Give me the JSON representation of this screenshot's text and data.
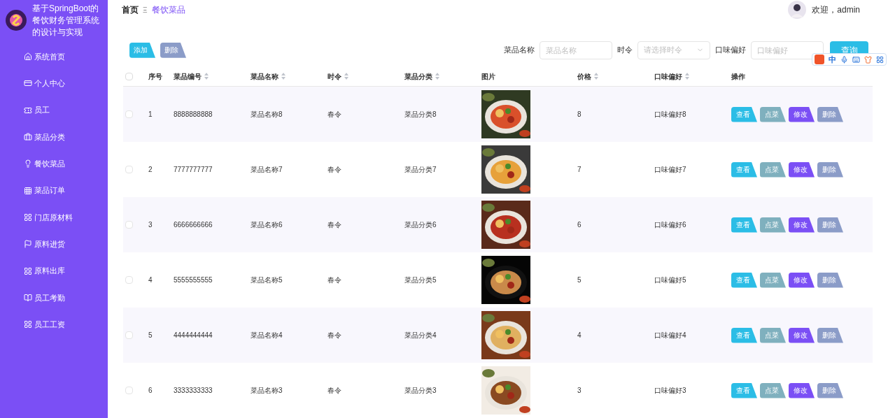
{
  "app": {
    "title": "基于SpringBoot的餐饮财务管理系统的设计与实现"
  },
  "sidebar": {
    "items": [
      "系统首页",
      "个人中心",
      "员工",
      "菜品分类",
      "餐饮菜品",
      "菜品订单",
      "门店原材料",
      "原料进货",
      "原料出库",
      "员工考勤",
      "员工工资"
    ]
  },
  "breadcrumb": {
    "home": "首页",
    "separator": "Ξ",
    "current": "餐饮菜品"
  },
  "user": {
    "greeting": "欢迎，admin"
  },
  "toolbar": {
    "add": "添加",
    "delete": "删除"
  },
  "search": {
    "fields": [
      {
        "kind": "input",
        "label": "菜品名称",
        "placeholder": "菜品名称"
      },
      {
        "kind": "select",
        "label": "时令",
        "placeholder": "请选择时令"
      },
      {
        "kind": "input",
        "label": "口味偏好",
        "placeholder": "口味偏好"
      }
    ],
    "button": "查询"
  },
  "ime_toolbar": {
    "mode": "中"
  },
  "table": {
    "all_checked": false,
    "columns": [
      {
        "label": "序号",
        "sortable": false
      },
      {
        "label": "菜品编号",
        "sortable": true
      },
      {
        "label": "菜品名称",
        "sortable": true
      },
      {
        "label": "时令",
        "sortable": true
      },
      {
        "label": "菜品分类",
        "sortable": true
      },
      {
        "label": "图片",
        "sortable": false
      },
      {
        "label": "价格",
        "sortable": true
      },
      {
        "label": "口味偏好",
        "sortable": true
      },
      {
        "label": "操作",
        "sortable": false
      }
    ],
    "rows": [
      {
        "checked": false,
        "index": "1",
        "code": "8888888888",
        "name": "菜品名称8",
        "season": "春令",
        "category": "菜品分类8",
        "price": "8",
        "taste": "口味偏好8",
        "actions": [
          {
            "kind": "view",
            "label": "查看"
          },
          {
            "kind": "order",
            "label": "点菜"
          },
          {
            "kind": "edit",
            "label": "修改"
          },
          {
            "kind": "delete",
            "label": "删除"
          }
        ]
      },
      {
        "checked": false,
        "index": "2",
        "code": "7777777777",
        "name": "菜品名称7",
        "season": "春令",
        "category": "菜品分类7",
        "price": "7",
        "taste": "口味偏好7",
        "actions": [
          {
            "kind": "view",
            "label": "查看"
          },
          {
            "kind": "order",
            "label": "点菜"
          },
          {
            "kind": "edit",
            "label": "修改"
          },
          {
            "kind": "delete",
            "label": "删除"
          }
        ]
      },
      {
        "checked": false,
        "index": "3",
        "code": "6666666666",
        "name": "菜品名称6",
        "season": "春令",
        "category": "菜品分类6",
        "price": "6",
        "taste": "口味偏好6",
        "actions": [
          {
            "kind": "view",
            "label": "查看"
          },
          {
            "kind": "order",
            "label": "点菜"
          },
          {
            "kind": "edit",
            "label": "修改"
          },
          {
            "kind": "delete",
            "label": "删除"
          }
        ]
      },
      {
        "checked": false,
        "index": "4",
        "code": "5555555555",
        "name": "菜品名称5",
        "season": "春令",
        "category": "菜品分类5",
        "price": "5",
        "taste": "口味偏好5",
        "actions": [
          {
            "kind": "view",
            "label": "查看"
          },
          {
            "kind": "order",
            "label": "点菜"
          },
          {
            "kind": "edit",
            "label": "修改"
          },
          {
            "kind": "delete",
            "label": "删除"
          }
        ]
      },
      {
        "checked": false,
        "index": "5",
        "code": "4444444444",
        "name": "菜品名称4",
        "season": "春令",
        "category": "菜品分类4",
        "price": "4",
        "taste": "口味偏好4",
        "actions": [
          {
            "kind": "view",
            "label": "查看"
          },
          {
            "kind": "order",
            "label": "点菜"
          },
          {
            "kind": "edit",
            "label": "修改"
          },
          {
            "kind": "delete",
            "label": "删除"
          }
        ]
      },
      {
        "checked": false,
        "index": "6",
        "code": "3333333333",
        "name": "菜品名称3",
        "season": "春令",
        "category": "菜品分类3",
        "price": "3",
        "taste": "口味偏好3",
        "actions": [
          {
            "kind": "view",
            "label": "查看"
          },
          {
            "kind": "order",
            "label": "点菜"
          },
          {
            "kind": "edit",
            "label": "修改"
          },
          {
            "kind": "delete",
            "label": "删除"
          }
        ]
      }
    ]
  }
}
